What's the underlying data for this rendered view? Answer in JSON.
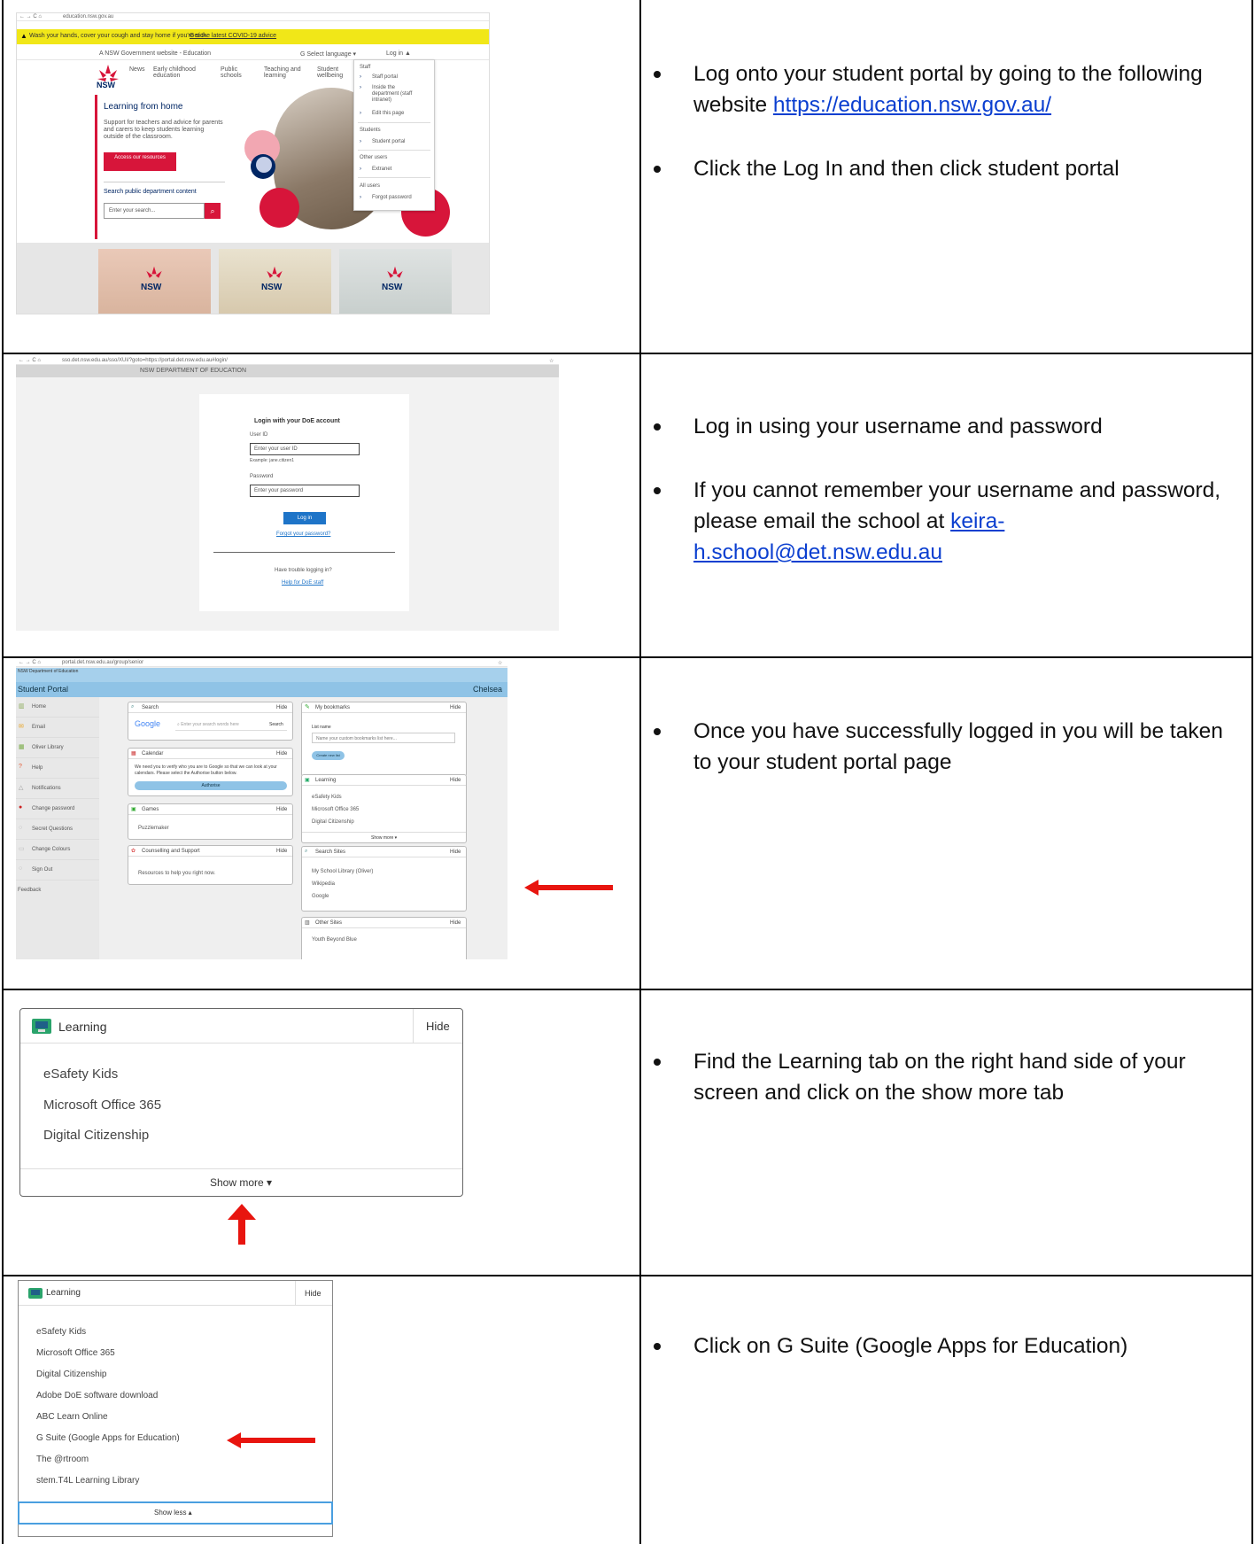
{
  "rows": [
    {
      "instructions": [
        {
          "text": "Log onto your student portal by going to the following website ",
          "link": "https://education.nsw.gov.au/"
        },
        {
          "text": "Click the Log In and then click student portal"
        }
      ]
    },
    {
      "instructions": [
        {
          "text": "Log in using your username and password"
        },
        {
          "text": "If you cannot remember your username and password, please email the school at ",
          "link": "keira-h.school@det.nsw.edu.au"
        }
      ]
    },
    {
      "instructions": [
        {
          "text": "Once you have successfully logged in you will be taken to your student portal page"
        }
      ]
    },
    {
      "instructions": [
        {
          "text": "Find the Learning tab on the right hand side of your screen and click on the show more tab"
        }
      ]
    },
    {
      "instructions": [
        {
          "text": "Click on G Suite (Google Apps for Education)"
        }
      ]
    }
  ],
  "shot1": {
    "url": "education.nsw.gov.au",
    "alert": "Wash your hands, cover your cough and stay home if you're sick.",
    "alert_link": "Get the latest COVID-19 advice",
    "gov_strip": "A NSW Government website - Education",
    "select_language": "Select language",
    "login": "Log in",
    "nav": [
      "News",
      "Early childhood education",
      "Public schools",
      "Teaching and learning",
      "Student wellbeing"
    ],
    "heading": "Learning from home",
    "intro": "Support for teachers and advice for parents and carers to keep students learning outside of the classroom.",
    "cta": "Access our resources",
    "search_heading": "Search public department content",
    "search_placeholder": "Enter your search...",
    "menu": {
      "staff": "Staff",
      "staff_portal": "Staff portal",
      "inside": "Inside the department (staff intranet)",
      "edit": "Edit this page",
      "students": "Students",
      "student_portal": "Student portal",
      "other": "Other users",
      "extranet": "Extranet",
      "all": "All users",
      "forgot": "Forgot password"
    },
    "logo_text": "NSW"
  },
  "shot2": {
    "url": "sso.det.nsw.edu.au/sso/XUI/?goto=https://portal.det.nsw.edu.au#login/",
    "banner": "NSW DEPARTMENT OF EDUCATION",
    "title": "Login with your DoE account",
    "user_label": "User ID",
    "user_placeholder": "Enter your user ID",
    "user_example": "Example: jane.citizen1",
    "pw_label": "Password",
    "pw_placeholder": "Enter your password",
    "login_button": "Log in",
    "forgot": "Forgot your password?",
    "trouble": "Have trouble logging in?",
    "help": "Help for DoE staff"
  },
  "shot3": {
    "url": "portal.det.nsw.edu.au/group/senior",
    "dept": "NSW Department of Education",
    "portal_title": "Student Portal",
    "user": "Chelsea",
    "sidebar": [
      "Home",
      "Email",
      "Oliver Library",
      "Help",
      "Notifications",
      "Change password",
      "Secret Questions",
      "Change Colours",
      "Sign Out",
      "Feedback"
    ],
    "search_title": "Search",
    "google": "Google",
    "search_placeholder": "Enter your search words here",
    "search_btn": "Search",
    "hide": "Hide",
    "calendar_title": "Calendar",
    "calendar_text": "We need you to verify who you are to Google so that we can look at your calendars. Please select the Authorise button below.",
    "authorise": "Authorise",
    "games_title": "Games",
    "games_item": "Puzzlemaker",
    "counselling_title": "Counselling and Support",
    "counselling_item": "Resources to help you right now.",
    "bookmarks_title": "My bookmarks",
    "list_name": "List name",
    "bookmark_placeholder": "Name your custom bookmarks list here...",
    "create_list": "Create new list",
    "learning_title": "Learning",
    "learning_items": [
      "eSafety Kids",
      "Microsoft Office 365",
      "Digital Citizenship"
    ],
    "show_more": "Show more",
    "search_sites_title": "Search Sites",
    "search_sites": [
      "My School Library (Oliver)",
      "Wikipedia",
      "Google"
    ],
    "other_sites_title": "Other Sites",
    "other_sites_item": "Youth Beyond Blue"
  },
  "shot4": {
    "title": "Learning",
    "hide": "Hide",
    "items": [
      "eSafety Kids",
      "Microsoft Office 365",
      "Digital Citizenship"
    ],
    "show_more": "Show more ▾"
  },
  "shot5": {
    "title": "Learning",
    "hide": "Hide",
    "items": [
      "eSafety Kids",
      "Microsoft Office 365",
      "Digital Citizenship",
      "Adobe DoE software download",
      "ABC Learn Online",
      "G Suite (Google Apps for Education)",
      "The @rtroom",
      "stem.T4L Learning Library"
    ],
    "show_less": "Show less ▴"
  },
  "colors": {
    "nsw_red": "#d7153a",
    "arrow_red": "#e8150f",
    "portal_blue": "#8fc3e6",
    "alert_yellow": "#f1e718"
  }
}
